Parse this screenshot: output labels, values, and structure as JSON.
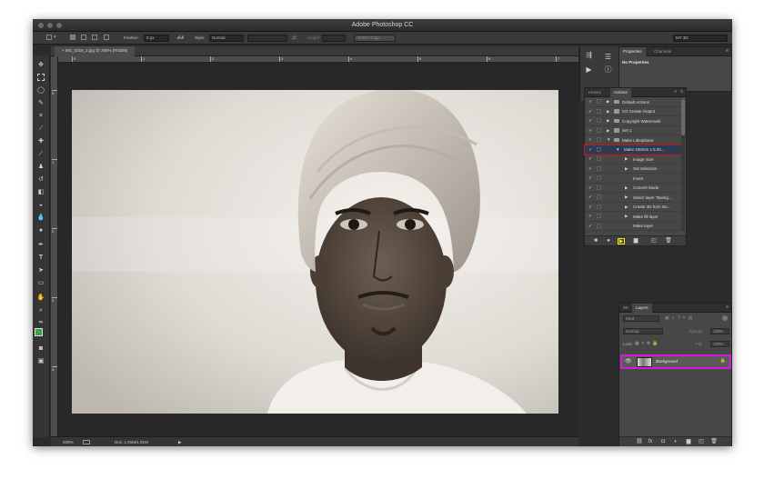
{
  "window": {
    "title": "Adobe Photoshop CC"
  },
  "options_bar": {
    "feather_label": "Feather:",
    "feather_value": "0 px",
    "style_label": "Style:",
    "style_value": "Normal",
    "width_label": "Width:",
    "height_label": "Height:",
    "refine_edge_label": "Refine Edge...",
    "workspace_value": "MY 3D"
  },
  "document": {
    "tab_label": "MG_0316_2.jpg @ 200% (RGB/8)",
    "zoom": "200%",
    "doc_info": "Doc: 1.91M/1.91M"
  },
  "rulers": {
    "h_labels": [
      "0",
      "1",
      "2",
      "3",
      "4",
      "5",
      "6",
      "7"
    ],
    "v_labels": [
      "0",
      "1",
      "2",
      "3",
      "4"
    ]
  },
  "properties_panel": {
    "tabs": [
      "Properties",
      "Channels"
    ],
    "body_text": "No Properties"
  },
  "actions_panel": {
    "tabs": [
      "History",
      "Actions"
    ],
    "rows": [
      {
        "label": "Default Actions",
        "level": 0,
        "type": "set",
        "checked": true
      },
      {
        "label": "CD Create Output",
        "level": 0,
        "type": "set",
        "checked": true
      },
      {
        "label": "Copyright Watermark",
        "level": 0,
        "type": "set",
        "checked": true
      },
      {
        "label": "Set 1",
        "level": 0,
        "type": "set",
        "checked": true
      },
      {
        "label": "Make Lithophane",
        "level": 0,
        "type": "set-open",
        "checked": true
      },
      {
        "label": "Make 100mm x 0.25...",
        "level": 1,
        "type": "action-open",
        "checked": true,
        "highlight": "red"
      },
      {
        "label": "Image Size",
        "level": 2,
        "type": "step",
        "checked": true
      },
      {
        "label": "Set Selection",
        "level": 2,
        "type": "step",
        "checked": true
      },
      {
        "label": "Invert",
        "level": 2,
        "type": "plain",
        "checked": true
      },
      {
        "label": "Convert Mode",
        "level": 2,
        "type": "step",
        "checked": true
      },
      {
        "label": "Select layer \"Backg...",
        "level": 2,
        "type": "step",
        "checked": true
      },
      {
        "label": "Create 3D from De...",
        "level": 2,
        "type": "step",
        "checked": true
      },
      {
        "label": "Make fill layer",
        "level": 2,
        "type": "step",
        "checked": true
      },
      {
        "label": "Make layer",
        "level": 2,
        "type": "plain",
        "checked": true
      }
    ],
    "highlight_colors": {
      "selected_row": "#c4161c",
      "play_button": "#f5e51b"
    }
  },
  "layers_panel": {
    "tabs": [
      "3D",
      "Layers"
    ],
    "kind_label": "Kind",
    "blend_mode": "Normal",
    "opacity_label": "Opacity:",
    "opacity_value": "100%",
    "lock_label": "Lock:",
    "fill_label": "Fill:",
    "fill_value": "100%",
    "layers": [
      {
        "name": "Background",
        "visible": true,
        "locked": true,
        "highlight": "#d51ad6"
      }
    ]
  }
}
